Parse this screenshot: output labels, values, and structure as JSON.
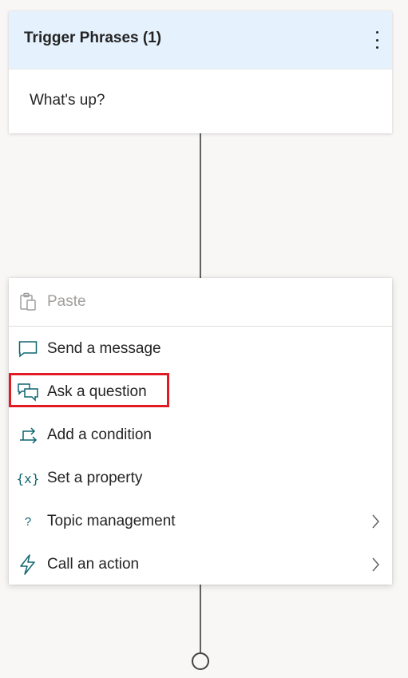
{
  "trigger": {
    "title": "Trigger Phrases (1)",
    "phrase": "What's up?"
  },
  "menu": {
    "paste": "Paste",
    "items": [
      {
        "label": "Send a message",
        "icon": "message-icon"
      },
      {
        "label": "Ask a question",
        "icon": "question-chat-icon"
      },
      {
        "label": "Add a condition",
        "icon": "branch-icon"
      },
      {
        "label": "Set a property",
        "icon": "variable-icon",
        "glyph": "{x}"
      },
      {
        "label": "Topic management",
        "icon": "question-mark-icon",
        "glyph": "?",
        "has_submenu": true
      },
      {
        "label": "Call an action",
        "icon": "lightning-icon",
        "has_submenu": true
      }
    ]
  },
  "colors": {
    "header_bg": "#e5f1fd",
    "accent": "#0f6570",
    "highlight": "#e01b24"
  }
}
